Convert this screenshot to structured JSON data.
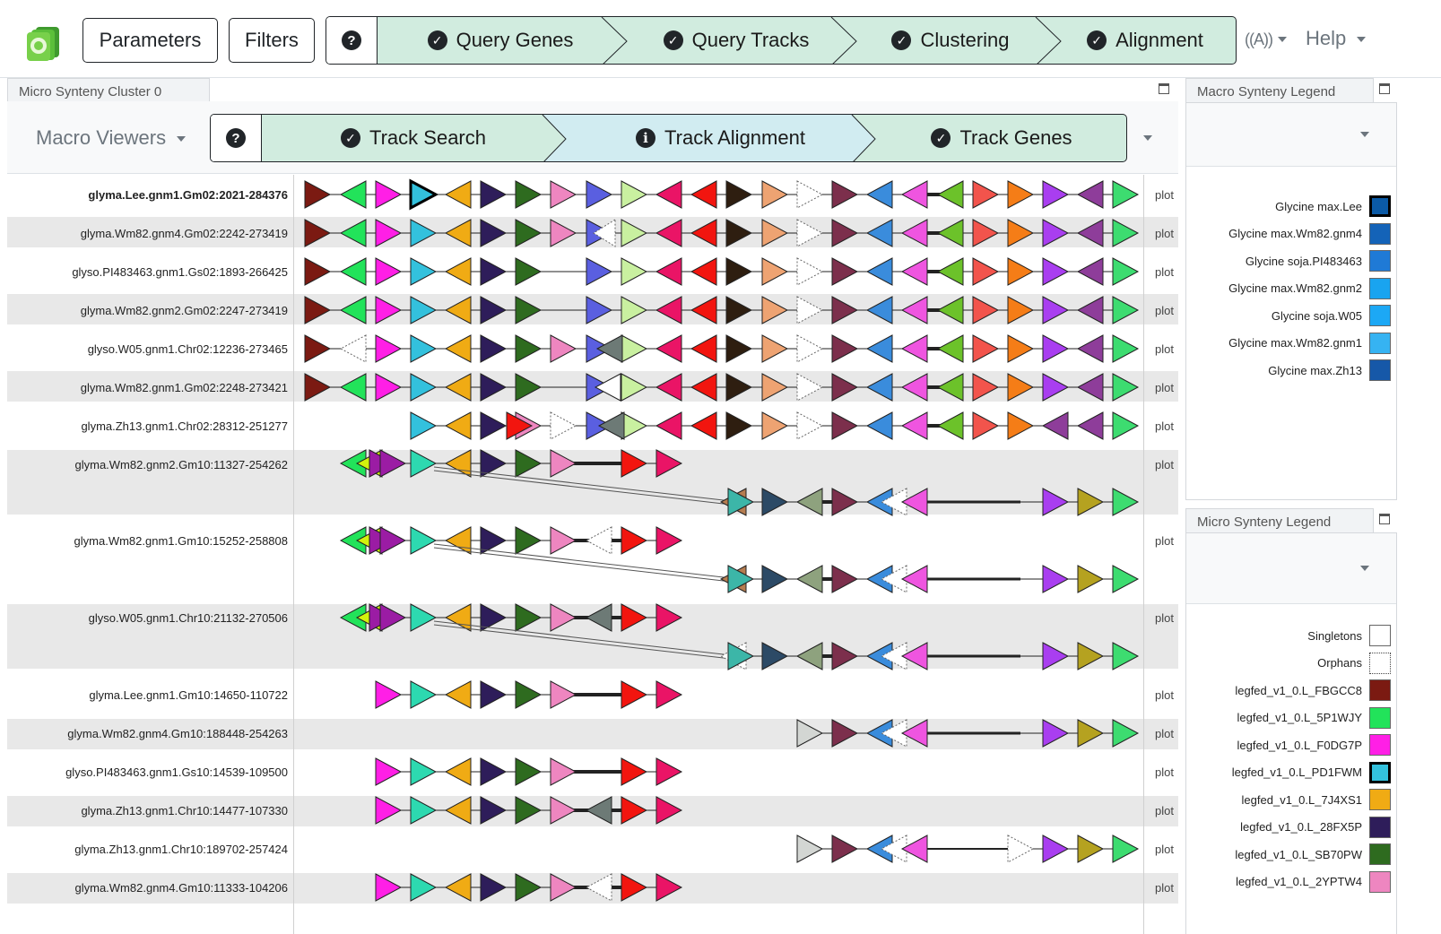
{
  "navbar": {
    "parameters_label": "Parameters",
    "filters_label": "Filters",
    "help_symbol": "?",
    "steps": [
      "Query Genes",
      "Query Tracks",
      "Clustering",
      "Alignment"
    ],
    "help_menu_label": "Help"
  },
  "micro_panel": {
    "tab_title": "Micro Synteny Cluster 0",
    "macro_viewers_label": "Macro Viewers",
    "help_symbol": "?",
    "steps": [
      {
        "label": "Track Search",
        "status": "complete"
      },
      {
        "label": "Track Alignment",
        "status": "info"
      },
      {
        "label": "Track Genes",
        "status": "complete"
      }
    ]
  },
  "tracks": [
    {
      "label": "glyma.Lee.gnm1.Gm02:2021-284376",
      "plot": "plot",
      "bold": true
    },
    {
      "label": "glyma.Wm82.gnm4.Gm02:2242-273419",
      "plot": "plot"
    },
    {
      "label": "glyso.PI483463.gnm1.Gs02:1893-266425",
      "plot": "plot"
    },
    {
      "label": "glyma.Wm82.gnm2.Gm02:2247-273419",
      "plot": "plot"
    },
    {
      "label": "glyso.W05.gnm1.Chr02:12236-273465",
      "plot": "plot"
    },
    {
      "label": "glyma.Wm82.gnm1.Gm02:2248-273421",
      "plot": "plot"
    },
    {
      "label": "glyma.Zh13.gnm1.Chr02:28312-251277",
      "plot": "plot"
    },
    {
      "label": "glyma.Wm82.gnm2.Gm10:11327-254262",
      "plot": "plot"
    },
    {
      "label": "glyma.Wm82.gnm1.Gm10:15252-258808",
      "plot": "plot"
    },
    {
      "label": "glyso.W05.gnm1.Chr10:21132-270506",
      "plot": "plot"
    },
    {
      "label": "glyma.Lee.gnm1.Gm10:14650-110722",
      "plot": "plot"
    },
    {
      "label": "glyma.Wm82.gnm4.Gm10:188448-254263",
      "plot": "plot"
    },
    {
      "label": "glyso.PI483463.gnm1.Gs10:14539-109500",
      "plot": "plot"
    },
    {
      "label": "glyma.Zh13.gnm1.Chr10:14477-107330",
      "plot": "plot"
    },
    {
      "label": "glyma.Zh13.gnm1.Chr10:189702-257424",
      "plot": "plot"
    },
    {
      "label": "glyma.Wm82.gnm4.Gm10:11333-104206",
      "plot": "plot"
    }
  ],
  "macro_legend": {
    "title": "Macro Synteny Legend",
    "items": [
      {
        "label": "Glycine max.Lee",
        "color": "#0b5aa6",
        "selected": true
      },
      {
        "label": "Glycine max.Wm82.gnm4",
        "color": "#1463b8"
      },
      {
        "label": "Glycine soja.PI483463",
        "color": "#1f7ad6"
      },
      {
        "label": "Glycine max.Wm82.gnm2",
        "color": "#19a4f0"
      },
      {
        "label": "Glycine soja.W05",
        "color": "#1ca8f5"
      },
      {
        "label": "Glycine max.Wm82.gnm1",
        "color": "#36b3f2"
      },
      {
        "label": "Glycine max.Zh13",
        "color": "#1658a8"
      }
    ]
  },
  "micro_legend": {
    "title": "Micro Synteny Legend",
    "items": [
      {
        "label": "Singletons",
        "color": "#ffffff",
        "style": "solid"
      },
      {
        "label": "Orphans",
        "color": "#ffffff",
        "style": "dotted"
      },
      {
        "label": "legfed_v1_0.L_FBGCC8",
        "color": "#7b1a12"
      },
      {
        "label": "legfed_v1_0.L_5P1WJY",
        "color": "#22e35a"
      },
      {
        "label": "legfed_v1_0.L_F0DG7P",
        "color": "#ff1fe6"
      },
      {
        "label": "legfed_v1_0.L_PD1FWM",
        "color": "#33c1dd",
        "selected": true
      },
      {
        "label": "legfed_v1_0.L_7J4XS1",
        "color": "#f0ab14"
      },
      {
        "label": "legfed_v1_0.L_28FX5P",
        "color": "#2e1d5a"
      },
      {
        "label": "legfed_v1_0.L_SB70PW",
        "color": "#2e6b1f"
      },
      {
        "label": "legfed_v1_0.L_2YPTW4",
        "color": "#ee86c0"
      }
    ]
  }
}
